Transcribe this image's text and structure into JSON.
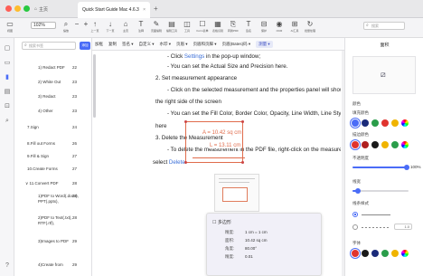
{
  "window": {
    "home_tab": "主页",
    "active_tab": "Quick Start Guide Mac 4.6.3",
    "tab_close": "×",
    "tab_add": "+"
  },
  "toolbar": {
    "zoom_value": "102%",
    "items": [
      {
        "icon": "▭",
        "label": "视图"
      },
      {
        "icon": "⌕",
        "label": "缩放"
      },
      {
        "icon": "−",
        "label": ""
      },
      {
        "icon": "+",
        "label": ""
      },
      {
        "icon": "↑",
        "label": "上一页"
      },
      {
        "icon": "↓",
        "label": "下一页"
      },
      {
        "icon": "⌂",
        "label": "主页"
      },
      {
        "icon": "T",
        "label": "注释"
      },
      {
        "icon": "✎",
        "label": "页面编辑"
      },
      {
        "icon": "▤",
        "label": "编辑工具"
      },
      {
        "icon": "◫",
        "label": "工具"
      },
      {
        "icon": "☐",
        "label": "Form表单"
      },
      {
        "icon": "▦",
        "label": "表格识别"
      },
      {
        "icon": "⎘",
        "label": "转换PDF"
      },
      {
        "icon": "T",
        "label": "签名"
      },
      {
        "icon": "⊟",
        "label": "保护"
      },
      {
        "icon": "◉",
        "label": "OCR"
      },
      {
        "icon": "⊞",
        "label": "AI工具"
      },
      {
        "icon": "↻",
        "label": "批量处理"
      }
    ],
    "search_placeholder": "搜索"
  },
  "subbar": {
    "items": [
      "加框",
      "复制",
      "签名 ▾",
      "自定义 ▾",
      "水印 ▾",
      "页眉 ▾",
      "页眉和页脚 ▾",
      "页眉(Bates)码 ▾",
      "测量 ▾"
    ]
  },
  "bookmarks": {
    "search_placeholder": "搜索书签",
    "add_button": "添加",
    "rows": [
      {
        "label": "1) Redact PDF",
        "page": "22"
      },
      {
        "label": "2) White Out",
        "page": "23"
      },
      {
        "label": "3) Redact",
        "page": "23"
      },
      {
        "label": "4) Other",
        "page": "23"
      },
      {
        "label": "7.Sign",
        "page": "24"
      },
      {
        "label": "8.Fill out Forms",
        "page": "26"
      },
      {
        "label": "9.Fill & Sign",
        "page": "27"
      },
      {
        "label": "10.Create Forms",
        "page": "27"
      },
      {
        "label": "∨ 11.Convert PDF",
        "page": "28"
      },
      {
        "label": "1)PDF to Word(.docx), PPT(.pptx),",
        "page": "28"
      },
      {
        "label": "2)PDF to Text(.txt), RTF(.rtf),",
        "page": "28"
      },
      {
        "label": "3)Images to PDF",
        "page": "29"
      },
      {
        "label": "4)Create from",
        "page": "29"
      }
    ]
  },
  "document": {
    "lines": [
      {
        "text": "- Click ",
        "link": "Settings",
        "after": " in the pop-up window;"
      },
      {
        "text": "- You can set the Actual Size and Precision here.",
        "link": "",
        "after": ""
      },
      {
        "text": "2. Set measurement appearance",
        "link": "",
        "after": ""
      },
      {
        "text": "- Click on the selected measurement and the properties panel will show up on",
        "link": "",
        "after": ""
      },
      {
        "text": "the right side of the screen",
        "link": "",
        "after": ""
      },
      {
        "text": "- You can set the Fill Color, Border Color, Opacity, Line Width, Line Style",
        "link": "",
        "after": ""
      },
      {
        "text": "here",
        "link": "",
        "after": ""
      },
      {
        "text": "3. Delete the Measurement",
        "link": "",
        "after": ""
      },
      {
        "text": "- To delete the measurement in the PDF file, right-click on the measurement,",
        "link": "",
        "after": ""
      },
      {
        "text": "select ",
        "link": "Delete",
        "after": "."
      }
    ],
    "area_label": "A = 10.42 sq cm",
    "length_label": "L = 13.11 cm"
  },
  "info_panel": {
    "title": "多边形",
    "rows": [
      {
        "key": "精度:",
        "value": "1 cm = 1 cm"
      },
      {
        "key": "面积:",
        "value": "10.42 sq cm"
      },
      {
        "key": "角度:",
        "value": "80.00°"
      },
      {
        "key": "精度:",
        "value": "0.01"
      }
    ]
  },
  "right_panel": {
    "title": "面积",
    "fill_label": "颜色",
    "fill_color_label": "填充颜色",
    "border_color_label": "描边颜色",
    "opacity_label": "不透明度",
    "opacity_value": "100%",
    "width_label": "线宽",
    "style_label": "线条样式",
    "style_value": "1.0",
    "bottom_label": "字体",
    "colors": {
      "row1": [
        "#4a6cf7",
        "#1a2a7a",
        "#2a9d4a",
        "#e0342f",
        "#f0b400"
      ],
      "row2": [
        "#e0342f",
        "#b02020",
        "#1a1a1a",
        "#f0b400",
        "#2a9d4a"
      ],
      "row3": [
        "#e0342f",
        "#1a1a1a",
        "#1a2a7a",
        "#2a9d4a",
        "#f0b400"
      ]
    }
  }
}
